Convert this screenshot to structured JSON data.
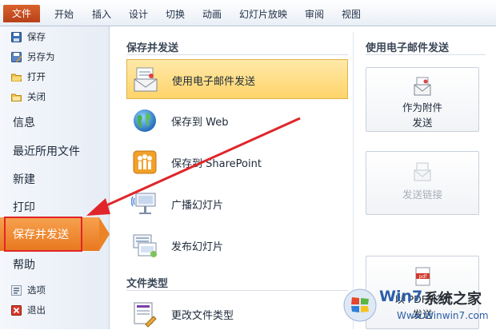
{
  "ribbon": {
    "file_tab": "文件",
    "tabs": [
      "开始",
      "插入",
      "设计",
      "切换",
      "动画",
      "幻灯片放映",
      "审阅",
      "视图"
    ]
  },
  "nav": {
    "save": "保存",
    "save_as": "另存为",
    "open": "打开",
    "close": "关闭",
    "info": "信息",
    "recent": "最近所用文件",
    "new": "新建",
    "print": "打印",
    "save_send": "保存并发送",
    "help": "帮助",
    "options": "选项",
    "exit": "退出"
  },
  "middle": {
    "section_title": "保存并发送",
    "items": [
      {
        "label": "使用电子邮件发送",
        "icon": "email-send-icon",
        "active": true
      },
      {
        "label": "保存到 Web",
        "icon": "globe-icon"
      },
      {
        "label": "保存到 SharePoint",
        "icon": "sharepoint-icon"
      },
      {
        "label": "广播幻灯片",
        "icon": "broadcast-icon"
      },
      {
        "label": "发布幻灯片",
        "icon": "publish-slides-icon"
      }
    ],
    "file_types_title": "文件类型",
    "file_type_item": "更改文件类型"
  },
  "right": {
    "title": "使用电子邮件发送",
    "attach_label_line1": "作为附件",
    "attach_label_line2": "发送",
    "link_label": "发送链接",
    "pdf_label": "以 PDF 形式",
    "pdf_label2": "发送"
  },
  "watermark": {
    "logo_text": "Win7",
    "site_name": "系统之家",
    "url": "Www.Winwin7.com"
  },
  "colors": {
    "accent_orange": "#e8781f",
    "file_tab": "#c8512a",
    "highlight_red": "#e0262a",
    "selected_item": "#ffd46a"
  }
}
